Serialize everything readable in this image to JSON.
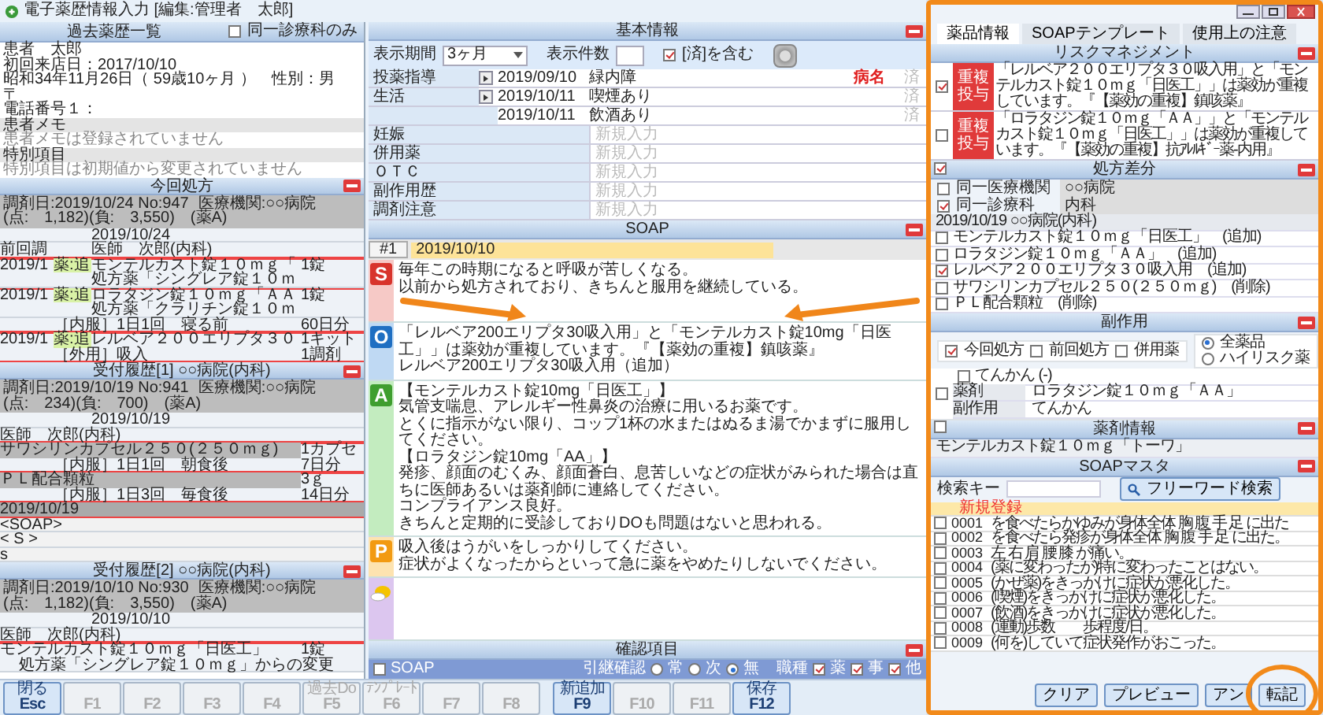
{
  "window": {
    "title": "電子薬歴情報入力 [編集:管理者　太郎]"
  },
  "left_panel": {
    "title": "過去薬歴一覧",
    "same_dept_only": {
      "label": "同一診療科のみ",
      "checked": false
    },
    "patient": [
      {
        "kind": "value",
        "text": "患者　太郎"
      },
      {
        "kind": "value",
        "text": "初回来店日：2017/10/10"
      },
      {
        "kind": "value",
        "text": "昭和34年11月26日（ 59歳10ヶ月 ）　性別：男"
      },
      {
        "kind": "value",
        "text": "〒"
      },
      {
        "kind": "value",
        "text": "電話番号１："
      },
      {
        "kind": "label",
        "text": "患者メモ"
      },
      {
        "kind": "note",
        "text": "患者メモは登録されていません"
      },
      {
        "kind": "label",
        "text": "特別項目"
      },
      {
        "kind": "note",
        "text": "特別項目は初期値から変更されていません"
      }
    ],
    "sections": [
      {
        "title": "今回処方",
        "info": [
          "調剤日:2019/10/24 No:947",
          "医療機関:○○病院",
          "(点:　1,182)(負:　3,550)　(薬A)"
        ],
        "rows": [
          {
            "kind": "date",
            "text": "2019/10/24"
          },
          {
            "kind": "doctor",
            "date": "前回調",
            "text": "医師　次郎(内科)"
          },
          {
            "kind": "drug",
            "date": "2019/1",
            "tag": "薬:追",
            "text": "モンテルカスト錠１０ｍｇ「",
            "qty": "1錠"
          },
          {
            "kind": "sub",
            "text": "処方薬「シングレア錠１０ｍ"
          },
          {
            "kind": "drug",
            "date": "2019/1",
            "tag": "薬:追",
            "text": "ロラタジン錠１０ｍｇ「ＡＡ",
            "qty": "1錠"
          },
          {
            "kind": "sub",
            "text": "処方薬「クラリチン錠１０ｍ"
          },
          {
            "kind": "usage",
            "text": "［内服］1日1回　寝る前",
            "qty": "60日分"
          },
          {
            "kind": "drug",
            "date": "2019/1",
            "tag": "薬:追",
            "text": "レルベア２００エリプタ３０",
            "qty": "1キット"
          },
          {
            "kind": "usage",
            "text": "［外用］吸入",
            "qty": "1調剤"
          }
        ]
      },
      {
        "title": "受付履歴[1] ○○病院(内科)",
        "info": [
          "調剤日:2019/10/19 No:941",
          "医療機関:○○病院",
          "(点:　234)(負:　700)　(薬A)"
        ],
        "rows": [
          {
            "kind": "date",
            "text": "2019/10/19"
          },
          {
            "kind": "doctor",
            "text": "医師　次郎(内科)"
          },
          {
            "kind": "item",
            "highlighted": true,
            "text": "サワシリンカプセル２５０(２５０ｍｇ)",
            "qty": "1カプセ"
          },
          {
            "kind": "usage",
            "text": "［内服］1日1回　朝食後",
            "qty": "7日分"
          },
          {
            "kind": "item",
            "highlighted": true,
            "text": "ＰＬ配合顆粒",
            "qty": "3ｇ"
          },
          {
            "kind": "usage",
            "text": "［内服］1日3回　毎食後",
            "qty": "14日分"
          },
          {
            "kind": "soap_date",
            "text": "2019/10/19"
          },
          {
            "kind": "soap",
            "text": "<SOAP>"
          },
          {
            "kind": "soap",
            "text": "< S >"
          },
          {
            "kind": "soap",
            "text": "s"
          }
        ]
      },
      {
        "title": "受付履歴[2] ○○病院(内科)",
        "info": [
          "調剤日:2019/10/10 No:930",
          "医療機関:○○病院",
          "(点:　1,182)(負:　3,550)　(薬A)"
        ],
        "rows": [
          {
            "kind": "date",
            "text": "2019/10/10"
          },
          {
            "kind": "doctor",
            "text": "医師　次郎(内科)"
          },
          {
            "kind": "item",
            "highlighted": false,
            "text": "モンテルカスト錠１０ｍｇ「日医工」",
            "qty": "1錠"
          },
          {
            "kind": "change",
            "text": "処方薬「シングレア錠１０ｍｇ」からの変更"
          }
        ]
      }
    ]
  },
  "function_keys": [
    {
      "label": "閉る",
      "key": "Esc",
      "enabled": true
    },
    {
      "key": "F1",
      "enabled": false
    },
    {
      "key": "F2",
      "enabled": false
    },
    {
      "key": "F3",
      "enabled": false
    },
    {
      "key": "F4",
      "enabled": false
    },
    {
      "label": "過去Do",
      "key": "F5",
      "enabled": false
    },
    {
      "label": "ﾃﾝﾌﾟﾚｰﾄ",
      "key": "F6",
      "enabled": false
    },
    {
      "key": "F7",
      "enabled": false
    },
    {
      "key": "F8",
      "enabled": false
    },
    {
      "label": "新追加",
      "key": "F9",
      "enabled": true
    },
    {
      "key": "F10",
      "enabled": false
    },
    {
      "key": "F11",
      "enabled": false
    },
    {
      "label": "保存",
      "key": "F12",
      "enabled": true
    }
  ],
  "basic_info": {
    "title": "基本情報",
    "period": {
      "label": "表示期間",
      "value": "3ヶ月"
    },
    "count": {
      "label": "表示件数"
    },
    "include_done": {
      "label": "[済]を含む",
      "checked": true
    },
    "rows": [
      {
        "label": "投薬指導",
        "entries": [
          {
            "date": "2019/09/10",
            "text": "緑内障",
            "tag": "病名",
            "done": "済"
          }
        ]
      },
      {
        "label": "生活",
        "entries": [
          {
            "date": "2019/10/11",
            "text": "喫煙あり",
            "done": "済"
          },
          {
            "date": "2019/10/11",
            "text": "飲酒あり",
            "done": "済"
          }
        ]
      },
      {
        "label": "妊娠",
        "placeholder": "新規入力"
      },
      {
        "label": "併用薬",
        "placeholder": "新規入力"
      },
      {
        "label": "ＯＴＣ",
        "placeholder": "新規入力"
      },
      {
        "label": "副作用歴",
        "placeholder": "新規入力"
      },
      {
        "label": "調剤注意",
        "placeholder": "新規入力"
      }
    ]
  },
  "soap": {
    "title": "SOAP",
    "tab": {
      "number": "#1",
      "date": "2019/10/10"
    },
    "blocks": [
      {
        "kind": "S",
        "letter": "S",
        "lines": [
          "毎年この時期になると呼吸が苦しくなる。",
          "以前から処方されており、きちんと服用を継続している。"
        ]
      },
      {
        "kind": "O",
        "letter": "O",
        "lines": [
          "「レルベア200エリプタ30吸入用」と「モンテルカスト錠10mg「日医工」」は薬効が重複しています。『【薬効の重複】鎮咳薬』",
          "レルベア200エリプタ30吸入用（追加）"
        ]
      },
      {
        "kind": "A",
        "letter": "A",
        "lines": [
          "【モンテルカスト錠10mg「日医工」】",
          "気管支喘息、アレルギー性鼻炎の治療に用いるお薬です。",
          "とくに指示がない限り、コップ1杯の水またはぬるま湯でかまずに服用してください。",
          "【ロラタジン錠10mg「AA」】",
          "発疹、顔面のむくみ、顔面蒼白、息苦しいなどの症状がみられた場合は直ちに医師あるいは薬剤師に連絡してください。",
          "コンプライアンス良好。",
          "きちんと定期的に受診しておりDOも問題はないと思われる。"
        ]
      },
      {
        "kind": "P",
        "letter": "P",
        "lines": [
          "吸入後はうがいをしっかりしてください。",
          "症状がよくなったからといって急に薬をやめたりしないでください。"
        ]
      },
      {
        "kind": "memo"
      }
    ]
  },
  "confirm": {
    "title": "確認項目",
    "soap_check": {
      "label": "SOAP",
      "checked": false
    },
    "handover": {
      "label": "引継確認",
      "options": [
        {
          "label": "常",
          "selected": false
        },
        {
          "label": "次",
          "selected": false
        },
        {
          "label": "無",
          "selected": true
        }
      ]
    },
    "roles": {
      "label": "職種",
      "options": [
        {
          "label": "薬",
          "checked": true
        },
        {
          "label": "事",
          "checked": true
        },
        {
          "label": "他",
          "checked": true
        }
      ]
    }
  },
  "right_panel": {
    "tabs": [
      {
        "label": "薬品情報",
        "selected": true
      },
      {
        "label": "SOAPテンプレート",
        "selected": false
      },
      {
        "label": "使用上の注意",
        "selected": false
      }
    ],
    "risk": {
      "title": "リスクマネジメント",
      "items": [
        {
          "checked": true,
          "tag": "重複投与",
          "text": "「レルベア２００エリプタ３０吸入用」と「モンテルカスト錠１０ｍｇ「日医工」」は薬効が重複しています。『【薬効の重複】鎮咳薬』"
        },
        {
          "checked": false,
          "tag": "重複投与",
          "text": "「ロラタジン錠１０ｍｇ「ＡＡ」」と「モンテルカスト錠１０ｍｇ「日医工」」は薬効が重複しています。『【薬効の重複】抗ｱﾚﾙｷﾞｰ薬-内用』"
        }
      ]
    },
    "diff": {
      "title": "処方差分",
      "checked": true,
      "filters": [
        {
          "label": "同一医療機関",
          "checked": false,
          "value": "○○病院"
        },
        {
          "label": "同一診療科",
          "checked": true,
          "value": "内科"
        }
      ],
      "date": "2019/10/19 ○○病院(内科)",
      "items": [
        {
          "checked": false,
          "text": "モンテルカスト錠１０ｍｇ「日医工」　(追加)"
        },
        {
          "checked": false,
          "text": "ロラタジン錠１０ｍｇ「ＡＡ」　(追加)"
        },
        {
          "checked": true,
          "text": "レルベア２００エリプタ３０吸入用　(追加)"
        },
        {
          "checked": false,
          "text": "サワシリンカプセル２５０(２５０ｍｇ)　(削除)"
        },
        {
          "checked": false,
          "text": "ＰＬ配合顆粒　(削除)"
        }
      ]
    },
    "side_effects": {
      "title": "副作用",
      "filters": [
        {
          "label": "今回処方",
          "checked": true
        },
        {
          "label": "前回処方",
          "checked": false
        },
        {
          "label": "併用薬",
          "checked": false
        }
      ],
      "scope": [
        {
          "label": "全薬品",
          "selected": true
        },
        {
          "label": "ハイリスク薬",
          "selected": false
        }
      ],
      "entry": {
        "checked": false,
        "name": {
          "text": "てんかん (-)",
          "checked": false
        },
        "drug_label": "薬剤",
        "drug": "ロラタジン錠１０ｍｇ「ＡＡ」",
        "effect_label": "副作用",
        "effect": "てんかん"
      }
    },
    "drug_info": {
      "title": "薬剤情報",
      "checked": false,
      "text": "モンテルカスト錠１０ｍｇ「トーワ」"
    },
    "soap_master": {
      "title": "SOAPマスタ",
      "search_label": "検索キー",
      "search_button": "フリーワード検索",
      "new_entry": "新規登録",
      "items": [
        {
          "code": "0001",
          "text": "を食べたらかゆみが身体全体 胸 腹 手 足 に出た",
          "checked": false
        },
        {
          "code": "0002",
          "text": "を食べたら発疹が身体全体 胸 腹 手 足 に出た。",
          "checked": false
        },
        {
          "code": "0003",
          "text": "左 右 肩 腰 膝 が痛い。",
          "checked": false
        },
        {
          "code": "0004",
          "text": "(薬に変わったが)特に変わったことはない。",
          "checked": false
        },
        {
          "code": "0005",
          "text": "(かぜ薬)をきっかけに症状が悪化した。",
          "checked": false
        },
        {
          "code": "0006",
          "text": "(喫煙)をきっかけに症状が悪化した。",
          "checked": false
        },
        {
          "code": "0007",
          "text": "(飲酒)をきっかけに症状が悪化した。",
          "checked": false
        },
        {
          "code": "0008",
          "text": "(運動)歩数　　歩程度/日。",
          "checked": false
        },
        {
          "code": "0009",
          "text": "(何を)していて症状発作がおこった。",
          "checked": false
        }
      ]
    },
    "buttons": [
      {
        "label": "クリア",
        "highlighted": false
      },
      {
        "label": "プレビュー",
        "highlighted": false
      },
      {
        "label": "アン",
        "highlighted": false
      },
      {
        "label": "転記",
        "highlighted": true
      }
    ]
  }
}
